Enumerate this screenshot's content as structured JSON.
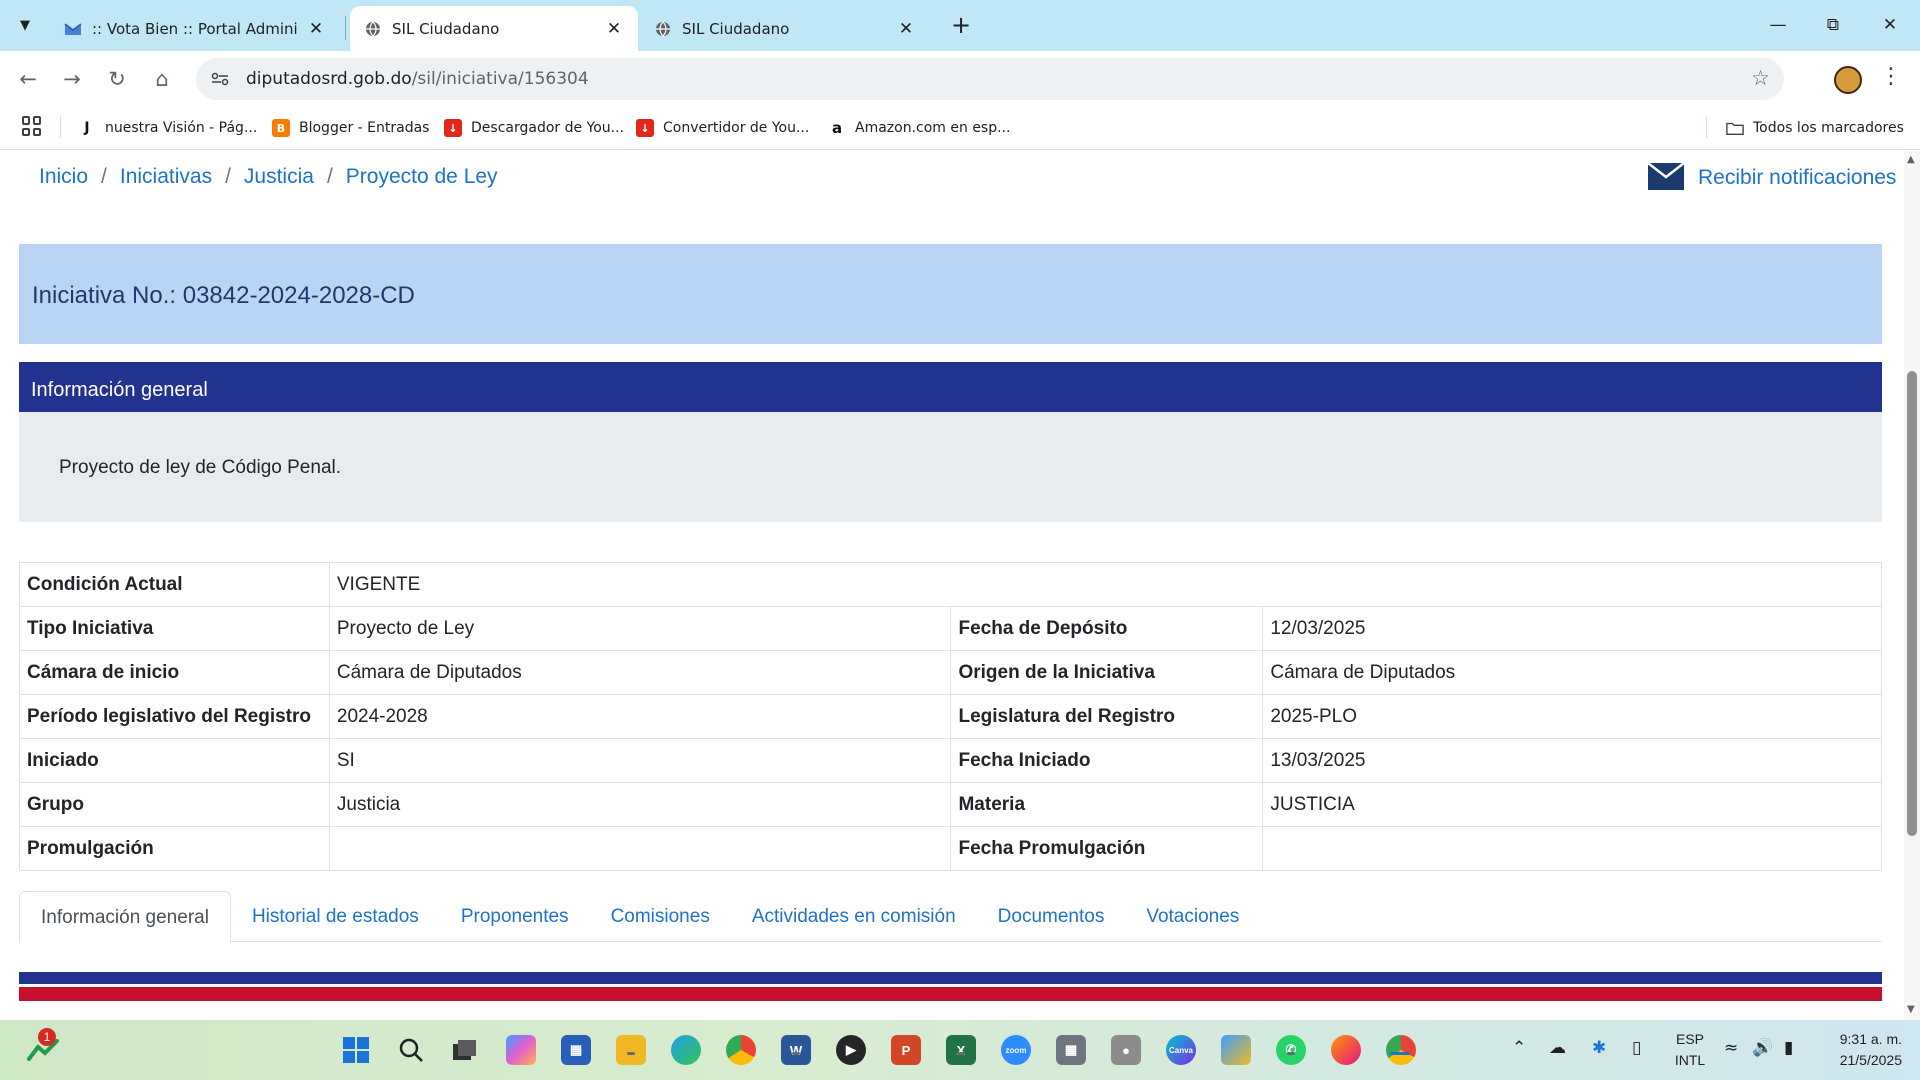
{
  "browser": {
    "tabs": [
      {
        "title": ":: Vota Bien :: Portal Administrati",
        "active": false
      },
      {
        "title": "SIL Ciudadano",
        "active": true
      },
      {
        "title": "SIL Ciudadano",
        "active": false
      }
    ],
    "url_host": "diputadosrd.gob.do",
    "url_path": "/sil/iniciativa/156304",
    "bookmarks": [
      "nuestra Visión - Pág...",
      "Blogger - Entradas",
      "Descargador de You...",
      "Convertidor de You...",
      "Amazon.com en esp..."
    ],
    "all_bookmarks": "Todos los marcadores"
  },
  "breadcrumb": {
    "items": [
      "Inicio",
      "Iniciativas",
      "Justicia",
      "Proyecto de Ley"
    ],
    "separator": "/"
  },
  "notify_label": "Recibir notificaciones",
  "initiative_title": "Iniciativa No.: 03842-2024-2028-CD",
  "info_general": {
    "header": "Información general",
    "description": "Proyecto de ley de Código Penal."
  },
  "details": {
    "condicion_label": "Condición Actual",
    "condicion_value": "VIGENTE",
    "rows": [
      {
        "l1": "Tipo Iniciativa",
        "v1": "Proyecto de Ley",
        "l2": "Fecha de Depósito",
        "v2": "12/03/2025"
      },
      {
        "l1": "Cámara de inicio",
        "v1": "Cámara de Diputados",
        "l2": "Origen de la Iniciativa",
        "v2": "Cámara de Diputados"
      },
      {
        "l1": "Período legislativo del Registro",
        "v1": "2024-2028",
        "l2": "Legislatura del Registro",
        "v2": "2025-PLO"
      },
      {
        "l1": "Iniciado",
        "v1": "SI",
        "l2": "Fecha Iniciado",
        "v2": "13/03/2025"
      },
      {
        "l1": "Grupo",
        "v1": "Justicia",
        "l2": "Materia",
        "v2": "JUSTICIA"
      },
      {
        "l1": "Promulgación",
        "v1": "",
        "l2": "Fecha Promulgación",
        "v2": ""
      }
    ]
  },
  "page_tabs": [
    "Información general",
    "Historial de estados",
    "Proponentes",
    "Comisiones",
    "Actividades en comisión",
    "Documentos",
    "Votaciones"
  ],
  "taskbar": {
    "notification_count": "1",
    "language": "ESP",
    "layout": "INTL",
    "time": "9:31 a. m.",
    "date": "21/5/2025"
  },
  "colors": {
    "link": "#1e73c8",
    "header_navy": "#21338f",
    "banner": "#b9d4f4",
    "stripe_red": "#c8102e"
  }
}
